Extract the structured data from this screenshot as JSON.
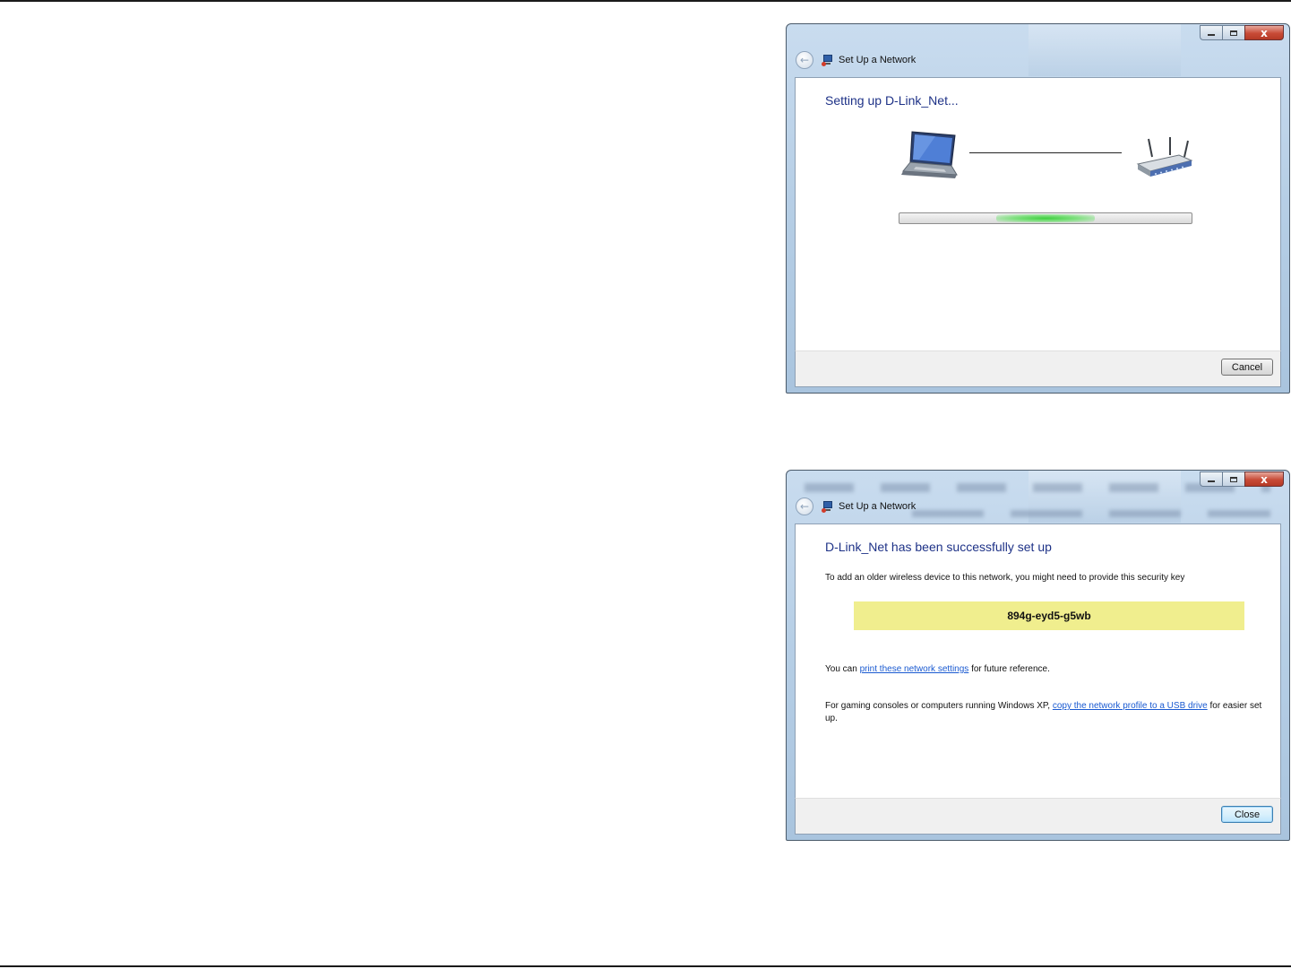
{
  "window_top": {
    "title": "Set Up a Network",
    "heading": "Setting up D-Link_Net...",
    "progress_fraction": 0.5,
    "cancel_label": "Cancel",
    "close_glyph": "x"
  },
  "window_bottom": {
    "title": "Set Up a Network",
    "heading": "D-Link_Net has been successfully set up",
    "description": "To add an older wireless device to this network, you might need to provide this security key",
    "security_key": "894g-eyd5-g5wb",
    "print_prefix": "You can ",
    "print_link": "print these network settings",
    "print_suffix": " for future reference.",
    "usb_prefix": "For gaming consoles or computers running Windows XP, ",
    "usb_link": "copy the network profile to a USB drive",
    "usb_suffix": " for easier set up.",
    "close_label": "Close",
    "close_glyph": "x"
  },
  "icons": [
    "back-arrow-icon",
    "network-icon",
    "laptop-icon",
    "router-icon",
    "minimize-icon",
    "maximize-icon",
    "close-icon"
  ],
  "colors": {
    "heading": "#1e3287",
    "link": "#1a5ad1",
    "key_highlight": "#f0ee8e",
    "progress_glow": "#3fcf3f",
    "close_button": "#c84a36"
  }
}
